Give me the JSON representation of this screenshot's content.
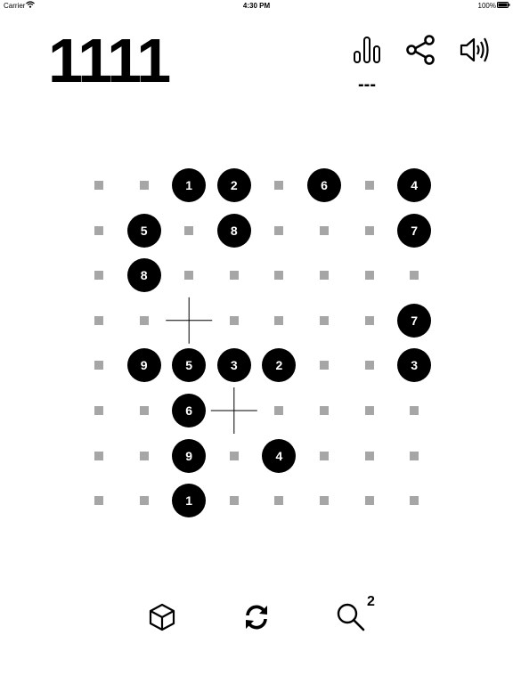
{
  "status_bar": {
    "carrier": "Carrier",
    "time": "4:30 PM",
    "battery": "100%"
  },
  "header": {
    "score": "1111",
    "best": "---",
    "icons": [
      "stats-icon",
      "share-icon",
      "sound-icon"
    ]
  },
  "board": {
    "rows": 8,
    "cols": 8,
    "cells": [
      [
        "",
        "",
        "1",
        "2",
        "",
        "6",
        "",
        "4"
      ],
      [
        "",
        "5",
        "",
        "8",
        "",
        "",
        "",
        "7"
      ],
      [
        "",
        "8",
        "",
        "",
        "",
        "",
        "",
        ""
      ],
      [
        "",
        "",
        "+",
        "",
        "",
        "",
        "",
        "7"
      ],
      [
        "",
        "9",
        "5",
        "3",
        "2",
        "",
        "",
        "3"
      ],
      [
        "",
        "",
        "6",
        "+",
        "",
        "",
        "",
        ""
      ],
      [
        "",
        "",
        "9",
        "",
        "4",
        "",
        "",
        ""
      ],
      [
        "",
        "",
        "1",
        "",
        "",
        "",
        "",
        ""
      ]
    ]
  },
  "footer": {
    "icons": [
      "cube-icon",
      "refresh-icon",
      "search-icon"
    ],
    "hint_count": "2"
  },
  "colors": {
    "circle": "#000000",
    "dot": "#a6a6a6",
    "background": "#ffffff"
  }
}
